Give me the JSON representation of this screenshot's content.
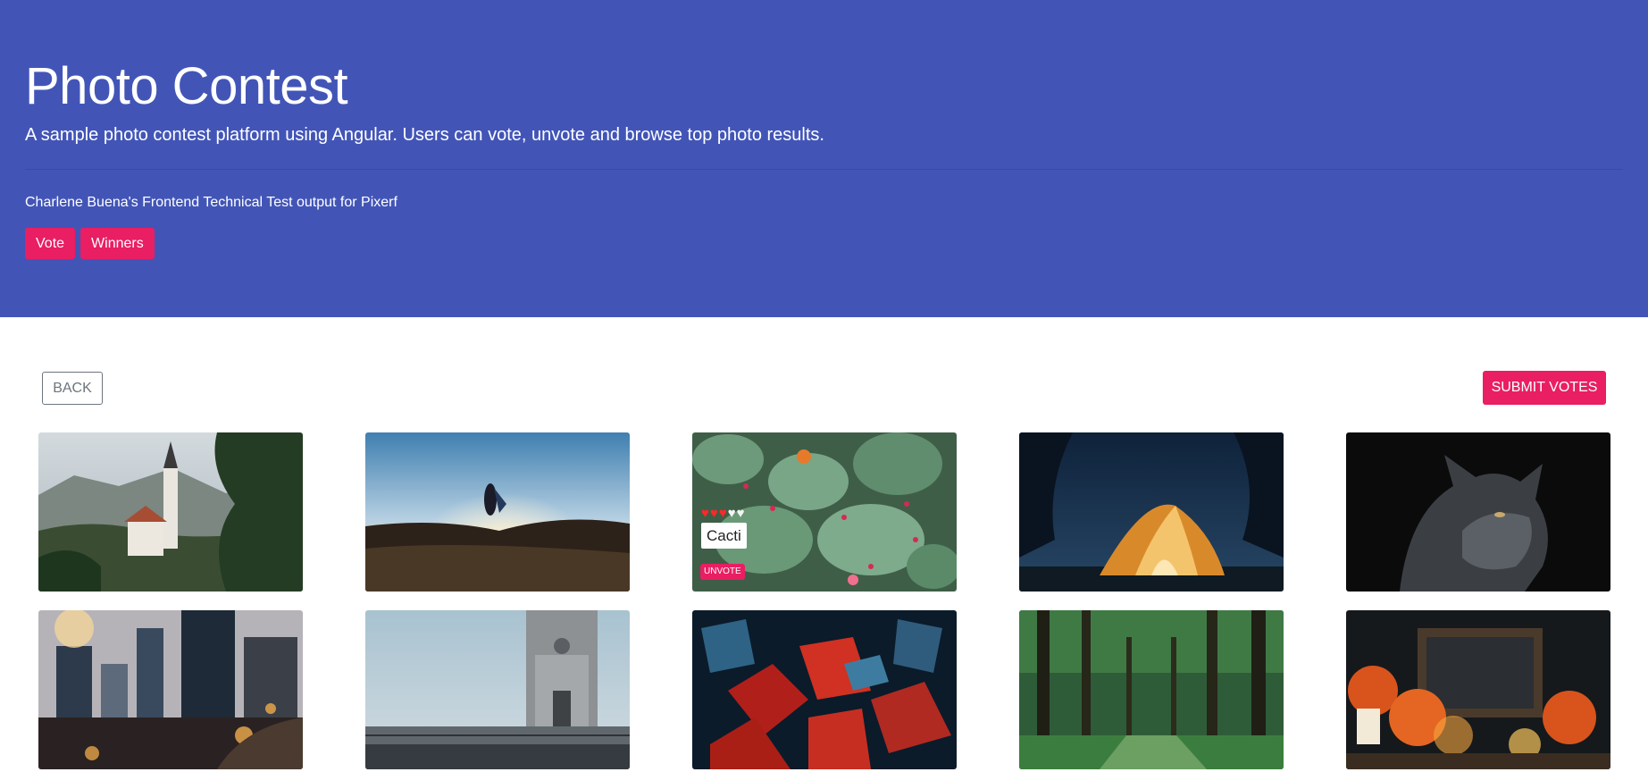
{
  "hero": {
    "title": "Photo Contest",
    "lead": "A sample photo contest platform using Angular. Users can vote, unvote and browse top photo results.",
    "credit": "Charlene Buena's Frontend Technical Test output for Pixerf",
    "buttons": {
      "vote": "Vote",
      "winners": "Winners"
    }
  },
  "toolbar": {
    "back": "BACK",
    "submit": "SUBMIT VOTES"
  },
  "photos": {
    "selected": {
      "title": "Cacti",
      "rating": 3,
      "max_rating": 5,
      "unvote": "UNVOTE"
    }
  },
  "colors": {
    "hero_bg": "#4255b7",
    "accent": "#e91e63",
    "heart_active": "#ff2828"
  }
}
